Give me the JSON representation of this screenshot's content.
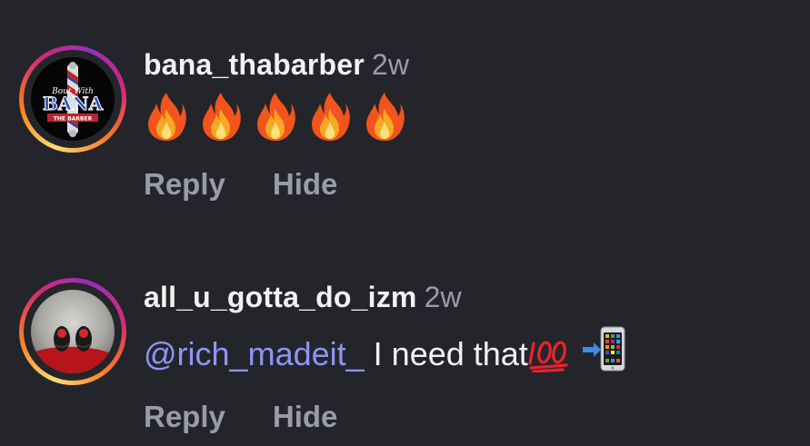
{
  "comments": [
    {
      "username": "bana_thabarber",
      "timestamp": "2w",
      "emoji": [
        "fire",
        "fire",
        "fire",
        "fire",
        "fire"
      ],
      "avatar_text": {
        "top": "Bout With",
        "main": "BANA",
        "bottom": "THE BARBER"
      },
      "actions": {
        "reply": "Reply",
        "hide": "Hide"
      }
    },
    {
      "username": "all_u_gotta_do_izm",
      "timestamp": "2w",
      "mention": "@rich_madeit_",
      "text": "I need that",
      "emoji_after": [
        "hundred-points-emoji",
        "mobile-phone-arrow-emoji"
      ],
      "actions": {
        "reply": "Reply",
        "hide": "Hide"
      }
    }
  ],
  "colors": {
    "background": "#24252a",
    "username": "#f2f2f2",
    "muted": "#9a9ca4",
    "mention": "#8f95f5"
  }
}
